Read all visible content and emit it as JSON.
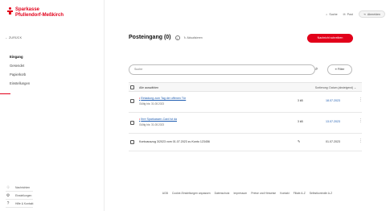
{
  "brand": {
    "name_line1": "Sparkasse",
    "name_line2": "Pfullendorf-Meßkirch",
    "color": "#e2001a"
  },
  "sidebar": {
    "back_label": "ZURÜCK",
    "items": [
      {
        "label": "Eingang",
        "active": true
      },
      {
        "label": "Gesendet",
        "active": false
      },
      {
        "label": "Papierkorb",
        "active": false
      },
      {
        "label": "Einstellungen",
        "active": false
      }
    ],
    "bottom": [
      {
        "label": "Nachrichten",
        "icon": "bell-icon"
      },
      {
        "label": "Einstellungen",
        "icon": "gear-icon"
      },
      {
        "label": "Hilfe & Kontakt",
        "icon": "help-icon"
      }
    ]
  },
  "topbar": {
    "search_label": "Suche",
    "post_label": "Post",
    "logout_label": "Abmelden"
  },
  "main": {
    "title": "Posteingang (0)",
    "refresh_label": "Aktualisieren",
    "new_message_label": "Nachricht schreiben",
    "search_placeholder": "Suche",
    "filter_label": "Filter",
    "select_all_label": "Alle auswählen",
    "sort_label": "Sortierung: Datum (absteigend)"
  },
  "messages": [
    {
      "subject": "Einladung zum Tag der offenen Tür",
      "date_line": "Gültig bis: 31.08.2023",
      "size": "3 kB",
      "date": "18.07.2023",
      "unread": true
    },
    {
      "subject": "Ihre Sparkassen-Card ist da",
      "date_line": "Gültig bis: 31.08.2023",
      "size": "3 kB",
      "date": "13.07.2023",
      "unread": true
    },
    {
      "subject": "Kontoauszug 3/2023 vom 01.07.2023 zu Konto 123456",
      "date_line": "",
      "size": "",
      "date": "01.07.2023",
      "unread": false,
      "attachment": true
    }
  ],
  "footer": {
    "links": [
      "AGB",
      "Cookie-Einstellungen anpassen",
      "Datenschutz",
      "Impressum",
      "Preise und Hinweise",
      "Kontakt",
      "Filiale A-Z",
      "Selbstkontrolle A-Z"
    ]
  }
}
